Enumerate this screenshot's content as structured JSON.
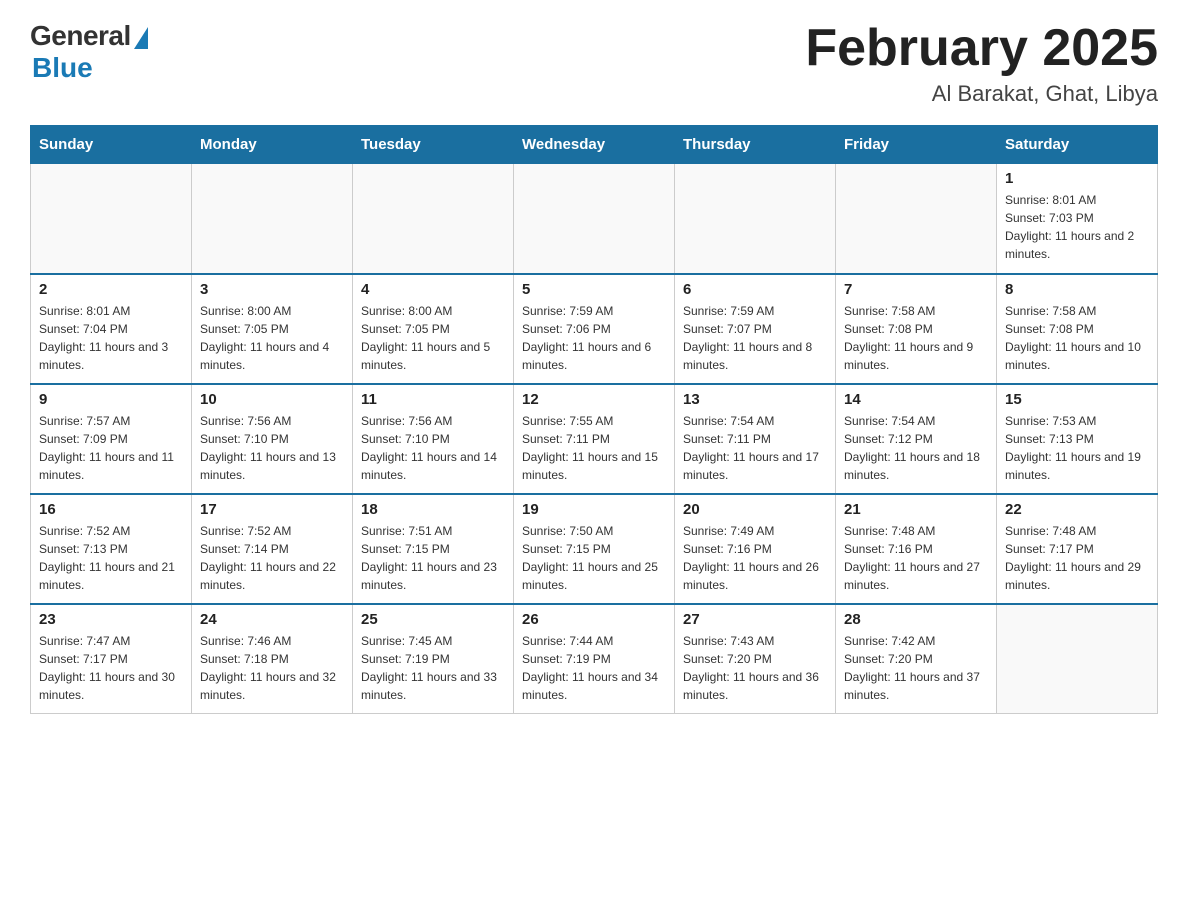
{
  "header": {
    "logo_general": "General",
    "logo_blue": "Blue",
    "month_title": "February 2025",
    "location": "Al Barakat, Ghat, Libya"
  },
  "weekdays": [
    "Sunday",
    "Monday",
    "Tuesday",
    "Wednesday",
    "Thursday",
    "Friday",
    "Saturday"
  ],
  "weeks": [
    {
      "days": [
        {
          "num": "",
          "info": ""
        },
        {
          "num": "",
          "info": ""
        },
        {
          "num": "",
          "info": ""
        },
        {
          "num": "",
          "info": ""
        },
        {
          "num": "",
          "info": ""
        },
        {
          "num": "",
          "info": ""
        },
        {
          "num": "1",
          "info": "Sunrise: 8:01 AM\nSunset: 7:03 PM\nDaylight: 11 hours and 2 minutes."
        }
      ]
    },
    {
      "days": [
        {
          "num": "2",
          "info": "Sunrise: 8:01 AM\nSunset: 7:04 PM\nDaylight: 11 hours and 3 minutes."
        },
        {
          "num": "3",
          "info": "Sunrise: 8:00 AM\nSunset: 7:05 PM\nDaylight: 11 hours and 4 minutes."
        },
        {
          "num": "4",
          "info": "Sunrise: 8:00 AM\nSunset: 7:05 PM\nDaylight: 11 hours and 5 minutes."
        },
        {
          "num": "5",
          "info": "Sunrise: 7:59 AM\nSunset: 7:06 PM\nDaylight: 11 hours and 6 minutes."
        },
        {
          "num": "6",
          "info": "Sunrise: 7:59 AM\nSunset: 7:07 PM\nDaylight: 11 hours and 8 minutes."
        },
        {
          "num": "7",
          "info": "Sunrise: 7:58 AM\nSunset: 7:08 PM\nDaylight: 11 hours and 9 minutes."
        },
        {
          "num": "8",
          "info": "Sunrise: 7:58 AM\nSunset: 7:08 PM\nDaylight: 11 hours and 10 minutes."
        }
      ]
    },
    {
      "days": [
        {
          "num": "9",
          "info": "Sunrise: 7:57 AM\nSunset: 7:09 PM\nDaylight: 11 hours and 11 minutes."
        },
        {
          "num": "10",
          "info": "Sunrise: 7:56 AM\nSunset: 7:10 PM\nDaylight: 11 hours and 13 minutes."
        },
        {
          "num": "11",
          "info": "Sunrise: 7:56 AM\nSunset: 7:10 PM\nDaylight: 11 hours and 14 minutes."
        },
        {
          "num": "12",
          "info": "Sunrise: 7:55 AM\nSunset: 7:11 PM\nDaylight: 11 hours and 15 minutes."
        },
        {
          "num": "13",
          "info": "Sunrise: 7:54 AM\nSunset: 7:11 PM\nDaylight: 11 hours and 17 minutes."
        },
        {
          "num": "14",
          "info": "Sunrise: 7:54 AM\nSunset: 7:12 PM\nDaylight: 11 hours and 18 minutes."
        },
        {
          "num": "15",
          "info": "Sunrise: 7:53 AM\nSunset: 7:13 PM\nDaylight: 11 hours and 19 minutes."
        }
      ]
    },
    {
      "days": [
        {
          "num": "16",
          "info": "Sunrise: 7:52 AM\nSunset: 7:13 PM\nDaylight: 11 hours and 21 minutes."
        },
        {
          "num": "17",
          "info": "Sunrise: 7:52 AM\nSunset: 7:14 PM\nDaylight: 11 hours and 22 minutes."
        },
        {
          "num": "18",
          "info": "Sunrise: 7:51 AM\nSunset: 7:15 PM\nDaylight: 11 hours and 23 minutes."
        },
        {
          "num": "19",
          "info": "Sunrise: 7:50 AM\nSunset: 7:15 PM\nDaylight: 11 hours and 25 minutes."
        },
        {
          "num": "20",
          "info": "Sunrise: 7:49 AM\nSunset: 7:16 PM\nDaylight: 11 hours and 26 minutes."
        },
        {
          "num": "21",
          "info": "Sunrise: 7:48 AM\nSunset: 7:16 PM\nDaylight: 11 hours and 27 minutes."
        },
        {
          "num": "22",
          "info": "Sunrise: 7:48 AM\nSunset: 7:17 PM\nDaylight: 11 hours and 29 minutes."
        }
      ]
    },
    {
      "days": [
        {
          "num": "23",
          "info": "Sunrise: 7:47 AM\nSunset: 7:17 PM\nDaylight: 11 hours and 30 minutes."
        },
        {
          "num": "24",
          "info": "Sunrise: 7:46 AM\nSunset: 7:18 PM\nDaylight: 11 hours and 32 minutes."
        },
        {
          "num": "25",
          "info": "Sunrise: 7:45 AM\nSunset: 7:19 PM\nDaylight: 11 hours and 33 minutes."
        },
        {
          "num": "26",
          "info": "Sunrise: 7:44 AM\nSunset: 7:19 PM\nDaylight: 11 hours and 34 minutes."
        },
        {
          "num": "27",
          "info": "Sunrise: 7:43 AM\nSunset: 7:20 PM\nDaylight: 11 hours and 36 minutes."
        },
        {
          "num": "28",
          "info": "Sunrise: 7:42 AM\nSunset: 7:20 PM\nDaylight: 11 hours and 37 minutes."
        },
        {
          "num": "",
          "info": ""
        }
      ]
    }
  ]
}
